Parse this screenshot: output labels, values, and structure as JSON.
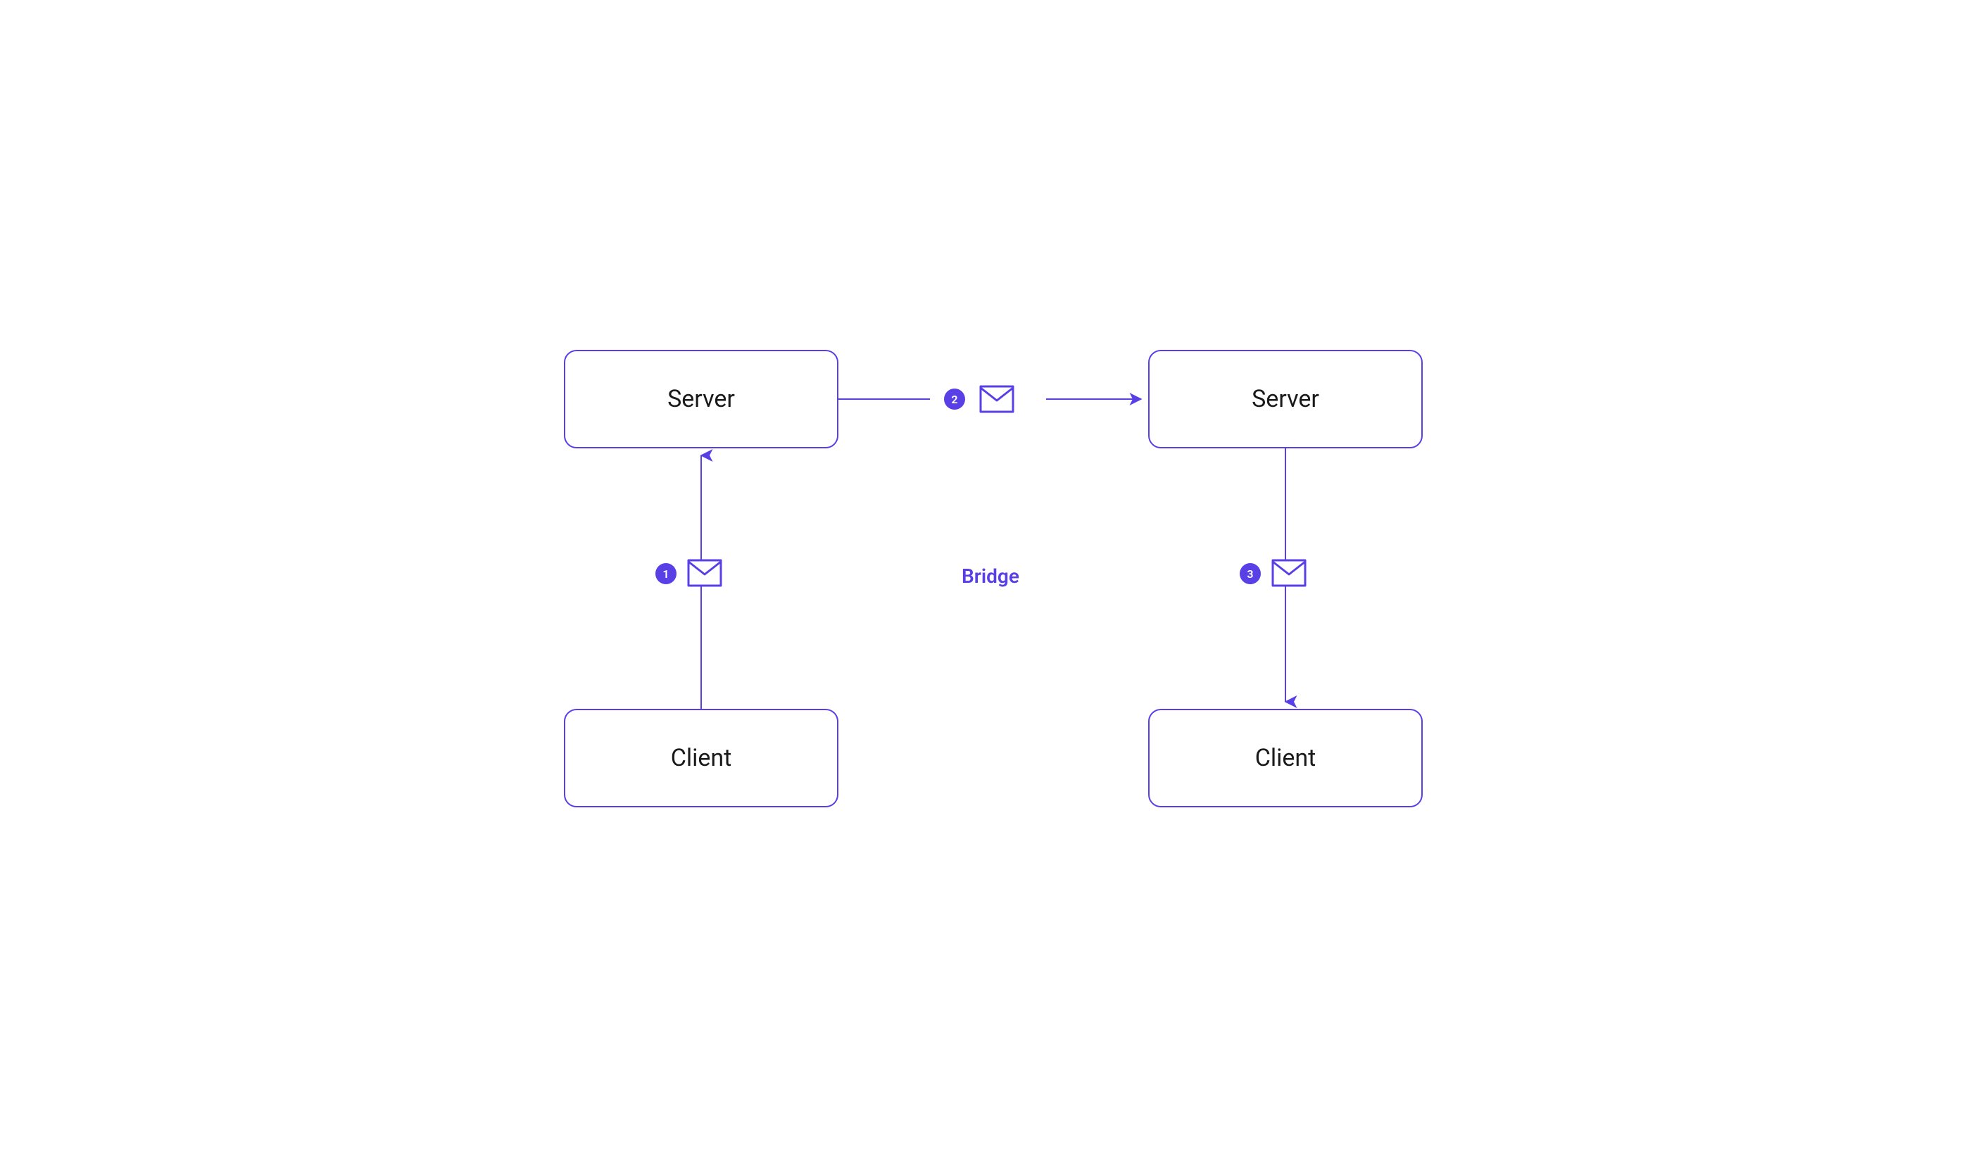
{
  "nodes": {
    "server_left": "Server",
    "server_right": "Server",
    "client_left": "Client",
    "client_right": "Client"
  },
  "bridge_label": "Bridge",
  "steps": {
    "s1": "1",
    "s2": "2",
    "s3": "3"
  },
  "colors": {
    "purple": "#5940e6",
    "purple_shadow": "#c8c0f8",
    "text": "#1a1a1a",
    "bg": "#ffffff"
  },
  "diagram": {
    "description": "Message flows from left Client up to left Server (step 1), then across a Bridge to right Server (step 2), then down to right Client (step 3).",
    "flow": [
      {
        "step": 1,
        "from": "client_left",
        "to": "server_left",
        "direction": "up"
      },
      {
        "step": 2,
        "from": "server_left",
        "to": "server_right",
        "direction": "right",
        "via": "Bridge"
      },
      {
        "step": 3,
        "from": "server_right",
        "to": "client_right",
        "direction": "down"
      }
    ]
  }
}
